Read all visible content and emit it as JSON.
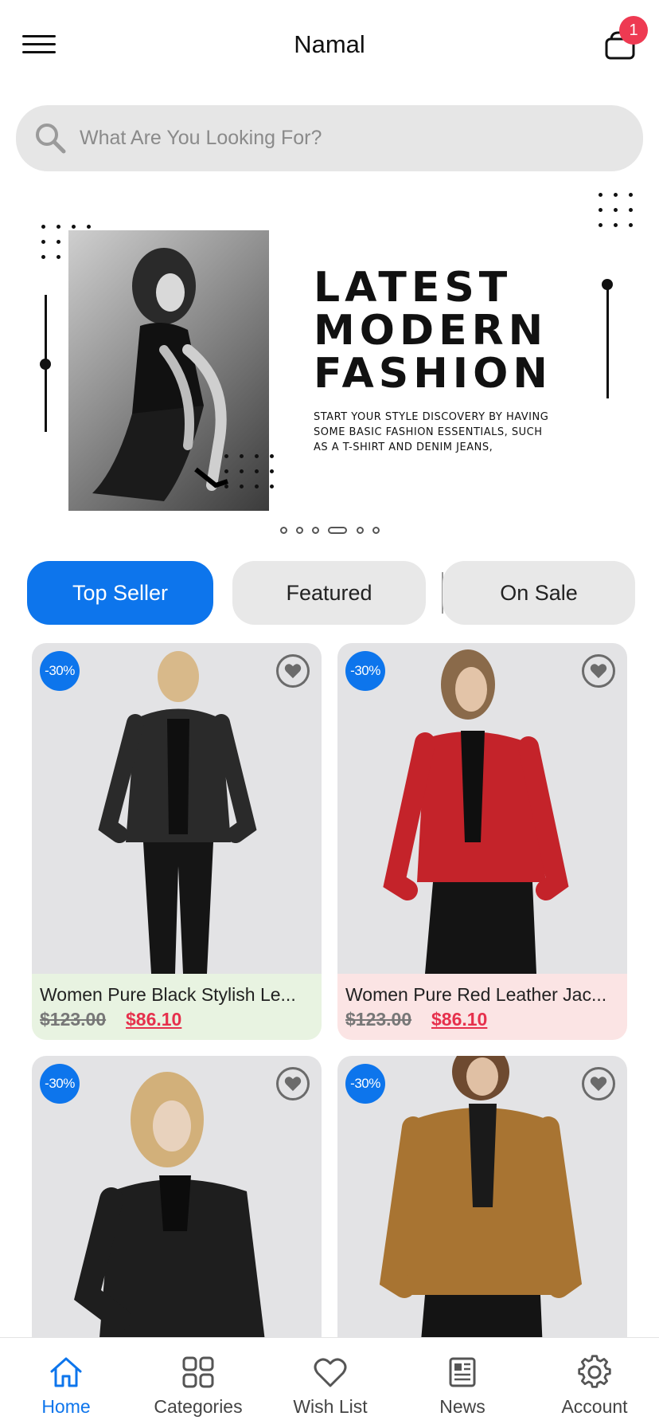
{
  "header": {
    "title": "Namal",
    "cart_badge": "1"
  },
  "search": {
    "placeholder": "What Are You Looking For?"
  },
  "banner": {
    "heading_lines": [
      "LATEST",
      "MODERN",
      "FASHION"
    ],
    "subtitle_lines": [
      "START YOUR STYLE DISCOVERY BY HAVING",
      "SOME BASIC FASHION ESSENTIALS, SUCH",
      "AS A T-SHIRT AND DENIM JEANS,"
    ],
    "pager_count": 6,
    "pager_active_index": 3
  },
  "tabs": [
    {
      "label": "Top Seller",
      "active": true
    },
    {
      "label": "Featured",
      "active": false
    },
    {
      "label": "On Sale",
      "active": false
    }
  ],
  "products": [
    {
      "name": "Women Pure Black Stylish Le...",
      "old_price": "$123.00",
      "new_price": "$86.10",
      "discount": "-30%",
      "info_bg": "#e8f3e1",
      "jacket_color": "#2a2a2a"
    },
    {
      "name": "Women Pure Red Leather Jac...",
      "old_price": "$123.00",
      "new_price": "$86.10",
      "discount": "-30%",
      "info_bg": "#fbe4e4",
      "jacket_color": "#c4232a"
    },
    {
      "name": "",
      "old_price": "",
      "new_price": "",
      "discount": "-30%",
      "info_bg": "#f3f3f3",
      "jacket_color": "#1e1e1e"
    },
    {
      "name": "",
      "old_price": "",
      "new_price": "",
      "discount": "-30%",
      "info_bg": "#f3f3f3",
      "jacket_color": "#a87432"
    }
  ],
  "bottom_nav": [
    {
      "label": "Home",
      "icon": "home-icon",
      "active": true
    },
    {
      "label": "Categories",
      "icon": "grid-icon",
      "active": false
    },
    {
      "label": "Wish List",
      "icon": "heart-icon",
      "active": false
    },
    {
      "label": "News",
      "icon": "newspaper-icon",
      "active": false
    },
    {
      "label": "Account",
      "icon": "gear-icon",
      "active": false
    }
  ],
  "colors": {
    "accent": "#0d75ec",
    "badge_red": "#ee3a52",
    "sale_price": "#e6304c"
  }
}
